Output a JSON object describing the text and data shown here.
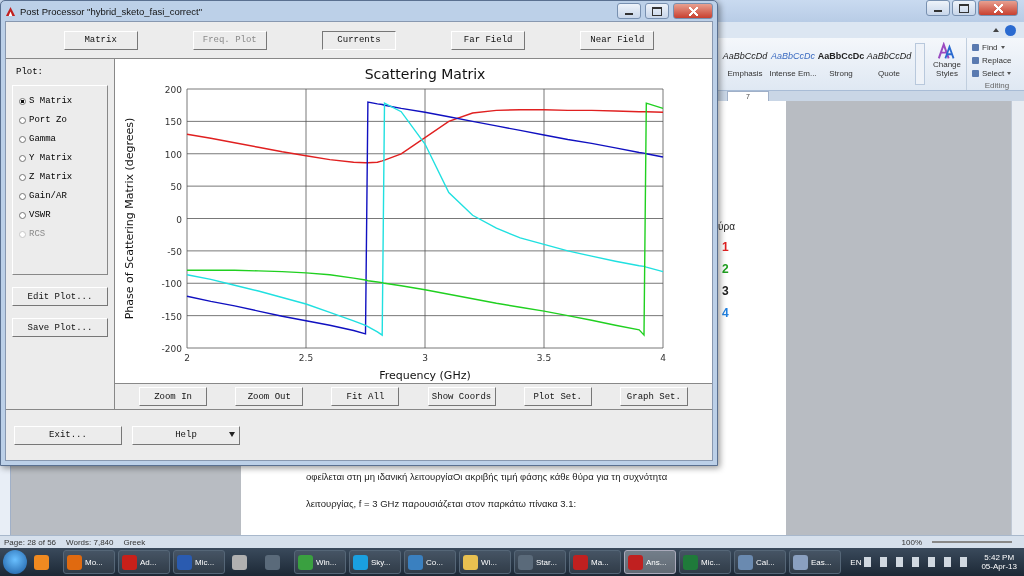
{
  "word": {
    "ribbon": {
      "styles": [
        {
          "sample": "AaBbCcDd",
          "name": "Emphasis",
          "kind": "italic"
        },
        {
          "sample": "AaBbCcDc",
          "name": "Intense Em...",
          "kind": "accent"
        },
        {
          "sample": "AaBbCcDc",
          "name": "Strong",
          "kind": "bold"
        },
        {
          "sample": "AaBbCcDd",
          "name": "Quote",
          "kind": "italic"
        }
      ],
      "change_styles": "Change Styles",
      "editing": [
        {
          "label": "Find",
          "has_menu": true
        },
        {
          "label": "Replace",
          "has_menu": false
        },
        {
          "label": "Select",
          "has_menu": true
        }
      ],
      "editing_label": "Editing"
    },
    "ruler_mark": "7",
    "document": {
      "table_header": "ύρα",
      "ports": [
        {
          "label": "1",
          "color": "#e02020"
        },
        {
          "label": "2",
          "color": "#20a020"
        },
        {
          "label": "3",
          "color": "#202020"
        },
        {
          "label": "4",
          "color": "#2080e0"
        }
      ],
      "paragraph": [
        "οφείλεται στη μη ιδανική λειτουργίαΟι ακριβής τιμή φάσης κάθε θύρα για τη συχνότητα",
        "λειτουργίας, f = 3 GHz παρουσιάζεται στον παρκάτω πίνακα 3.1:"
      ]
    },
    "status_bar": {
      "page": "Page: 28 of 56",
      "words": "Words: 7,840",
      "language": "Greek",
      "zoom": "100%"
    }
  },
  "post_processor": {
    "title": "Post Processor \"hybrid_sketo_fasi_correct\"",
    "top_buttons": [
      {
        "label": "Matrix",
        "disabled": false
      },
      {
        "label": "Freq. Plot",
        "disabled": true
      },
      {
        "label": "Currents",
        "disabled": false
      },
      {
        "label": "Far Field",
        "disabled": false
      },
      {
        "label": "Near Field",
        "disabled": false
      }
    ],
    "plot_label": "Plot:",
    "plot_options": [
      {
        "label": "S Matrix",
        "selected": true,
        "disabled": false
      },
      {
        "label": "Port Zo",
        "selected": false,
        "disabled": false
      },
      {
        "label": "Gamma",
        "selected": false,
        "disabled": false
      },
      {
        "label": "Y Matrix",
        "selected": false,
        "disabled": false
      },
      {
        "label": "Z Matrix",
        "selected": false,
        "disabled": false
      },
      {
        "label": "Gain/AR",
        "selected": false,
        "disabled": false
      },
      {
        "label": "VSWR",
        "selected": false,
        "disabled": false
      },
      {
        "label": "RCS",
        "selected": false,
        "disabled": true
      }
    ],
    "side_buttons": [
      "Edit Plot...",
      "Save Plot..."
    ],
    "chart": {
      "chart_data": {
        "type": "line",
        "title": "Scattering Matrix",
        "xlabel": "Frequency (GHz)",
        "ylabel": "Phase of Scattering Matrix (degrees)",
        "x": [
          2,
          2.1,
          2.2,
          2.3,
          2.4,
          2.5,
          2.6,
          2.7,
          2.75,
          2.76,
          2.8,
          2.82,
          2.83,
          2.9,
          3,
          3.1,
          3.2,
          3.3,
          3.4,
          3.5,
          3.6,
          3.7,
          3.8,
          3.9,
          3.92,
          3.93,
          4
        ],
        "grid": true,
        "series": [
          {
            "color": "#e02020",
            "values": [
              130,
              124,
              117,
              110,
              103,
              97,
              91,
              87,
              86,
              86,
              87,
              89,
              90,
              100,
              125,
              150,
              163,
              167,
              168,
              168,
              167,
              167,
              166,
              165,
              165,
              165,
              164
            ]
          },
          {
            "color": "#1010c0",
            "values": [
              -120,
              -128,
              -135,
              -143,
              -151,
              -158,
              -165,
              -173,
              -178,
              180,
              177,
              176,
              175,
              170,
              164,
              157,
              150,
              143,
              136,
              129,
              122,
              116,
              109,
              102,
              101,
              100,
              95
            ]
          },
          {
            "color": "#20e0e0",
            "values": [
              -87,
              -94,
              -103,
              -112,
              -122,
              -132,
              -145,
              -158,
              -165,
              -167,
              -175,
              -180,
              178,
              165,
              115,
              40,
              5,
              -15,
              -30,
              -40,
              -50,
              -58,
              -66,
              -73,
              -74,
              -75,
              -82
            ]
          },
          {
            "color": "#20d020",
            "values": [
              -80,
              -80,
              -80,
              -81,
              -82,
              -84,
              -87,
              -92,
              -95,
              -96,
              -98,
              -99,
              -100,
              -104,
              -110,
              -117,
              -124,
              -131,
              -137,
              -143,
              -150,
              -157,
              -165,
              -172,
              -180,
              178,
              170
            ]
          }
        ],
        "xlim": [
          2,
          4
        ],
        "ylim": [
          -200,
          200
        ],
        "xticks": [
          2,
          2.5,
          3,
          3.5,
          4
        ],
        "yticks": [
          -200,
          -150,
          -100,
          -50,
          0,
          50,
          100,
          150,
          200
        ]
      }
    },
    "chart_buttons": [
      "Zoom In",
      "Zoom Out",
      "Fit All",
      "Show Coords",
      "Plot Set.",
      "Graph Set."
    ],
    "bottom_buttons": [
      {
        "label": "Exit...",
        "has_menu": false
      },
      {
        "label": "Help",
        "has_menu": true
      }
    ]
  },
  "taskbar": {
    "items": [
      {
        "kind": "media",
        "selected": false
      },
      {
        "label": "Mo...",
        "kind": "browser",
        "selected": false
      },
      {
        "label": "Ad...",
        "kind": "pdf",
        "selected": false
      },
      {
        "label": "Mic...",
        "kind": "word",
        "selected": false
      },
      {
        "kind": "disc",
        "selected": false
      },
      {
        "kind": "sc",
        "selected": false
      },
      {
        "label": "Win...",
        "kind": "people",
        "selected": false
      },
      {
        "label": "Sky...",
        "kind": "chat",
        "selected": false
      },
      {
        "label": "Co...",
        "kind": "monitor",
        "selected": false
      },
      {
        "label": "Wi...",
        "kind": "folder",
        "selected": false
      },
      {
        "label": "Star...",
        "kind": "sc",
        "selected": false
      },
      {
        "label": "Ma...",
        "kind": "triangle",
        "selected": false
      },
      {
        "label": "Ans...",
        "kind": "triangle",
        "selected": true
      },
      {
        "label": "Mic...",
        "kind": "excel",
        "selected": false
      },
      {
        "label": "Cal...",
        "kind": "calc",
        "selected": false
      },
      {
        "label": "Eas...",
        "kind": "doc",
        "selected": false
      }
    ],
    "language": "EN",
    "time": "5:42 PM",
    "date": "05-Apr-13"
  }
}
